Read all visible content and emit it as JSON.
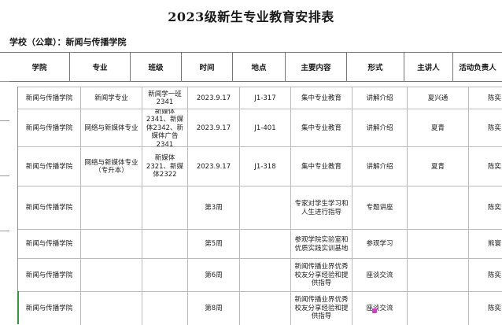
{
  "title": "2023级新生专业教育安排表",
  "school_line": "学校（公章）：新闻与传播学院",
  "headers": [
    "学院",
    "专业",
    "班级",
    "时间",
    "地点",
    "主要内容",
    "形式",
    "主讲人",
    "活动负责人"
  ],
  "rows": [
    {
      "college": "新闻与传播学院",
      "major": "新闻学专业",
      "class": "新闻学一班\n2341",
      "time": "2023.9.17",
      "place": "J1-317",
      "content": "集中专业教育",
      "format": "讲解介绍",
      "speaker": "夏兴通",
      "owner": "陈奕"
    },
    {
      "college": "新闻与传播学院",
      "major": "网络与新媒体专业",
      "class": "新媒体2341、新媒体2342、新媒体广告2341",
      "time": "2023.9.17",
      "place": "J1-401",
      "content": "集中专业教育",
      "format": "讲解介绍",
      "speaker": "夏青",
      "owner": "陈奕"
    },
    {
      "college": "新闻与传播学院",
      "major": "网络与新媒体专业（专升本）",
      "class": "新媒体2321、新媒体2322",
      "time": "2023.9.17",
      "place": "J1-318",
      "content": "集中专业教育",
      "format": "讲解介绍",
      "speaker": "夏青",
      "owner": "陈奕"
    },
    {
      "college": "新闻与传播学院",
      "major": "",
      "class": "",
      "time": "第3周",
      "place": "",
      "content": "专家对学生学习和人生进行指导",
      "format": "专题讲座",
      "speaker": "",
      "owner": "陈奕"
    },
    {
      "college": "新闻与传播学院",
      "major": "",
      "class": "",
      "time": "第5周",
      "place": "",
      "content": "参观学院实验室和优质实践实训基地",
      "format": "参观学习",
      "speaker": "",
      "owner": "熊寰"
    },
    {
      "college": "新闻与传播学院",
      "major": "",
      "class": "",
      "time": "第6周",
      "place": "",
      "content": "新闻传播业界优秀校友分享经验和提供指导",
      "format": "座谈交流",
      "speaker": "",
      "owner": "陈奕"
    },
    {
      "college": "新闻与传播学院",
      "major": "",
      "class": "",
      "time": "第8周",
      "place": "",
      "content": "新闻传播业界优秀校友分享经验和提供指导",
      "format": "座谈交流",
      "speaker": "",
      "owner": "陈奕"
    }
  ]
}
